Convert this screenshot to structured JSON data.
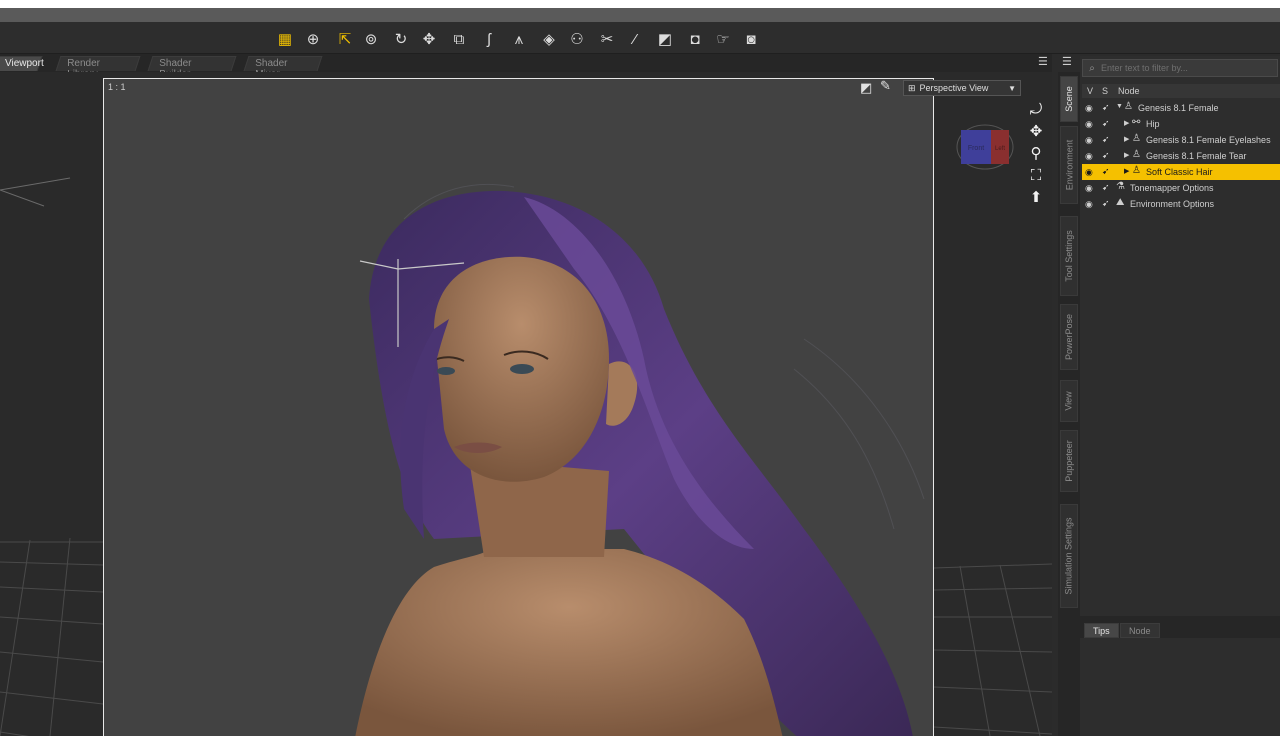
{
  "toolbar": {
    "tools": [
      {
        "name": "pixel-tool-icon",
        "glyph": "▦"
      },
      {
        "name": "universal-tool-icon",
        "glyph": "⊕"
      },
      {
        "name": "node-selection-icon",
        "glyph": "⇱"
      },
      {
        "name": "region-nav-icon",
        "glyph": "⊚"
      },
      {
        "name": "rotate-tool-icon",
        "glyph": "↻"
      },
      {
        "name": "translate-tool-icon",
        "glyph": "✥"
      },
      {
        "name": "scale-tool-icon",
        "glyph": "⧉"
      },
      {
        "name": "joint-editor-icon",
        "glyph": "ʃ"
      },
      {
        "name": "surface-tool-icon",
        "glyph": "⩚"
      },
      {
        "name": "geometry-editor-icon",
        "glyph": "◈"
      },
      {
        "name": "morph-tool-icon",
        "glyph": "⚇"
      },
      {
        "name": "active-pose-icon",
        "glyph": "✂"
      },
      {
        "name": "weight-brush-icon",
        "glyph": "⁄"
      },
      {
        "name": "geometry-sculptor-icon",
        "glyph": "◩"
      },
      {
        "name": "spot-render-icon",
        "glyph": "◘"
      },
      {
        "name": "pointer-icon",
        "glyph": "☞"
      },
      {
        "name": "camera-icon",
        "glyph": "◙"
      }
    ]
  },
  "tabs": [
    {
      "label": "Viewport",
      "active": true
    },
    {
      "label": "Render Library",
      "active": false
    },
    {
      "label": "Shader Builder",
      "active": false
    },
    {
      "label": "Shader Mixer",
      "active": false
    }
  ],
  "viewport": {
    "ratio_label": "1 : 1",
    "camera_label": "Perspective View",
    "navcube_front": "Front",
    "navcube_left": "Left"
  },
  "side_tabs": [
    {
      "label": "Scene",
      "active": true
    },
    {
      "label": "Environment",
      "active": false
    },
    {
      "label": "Tool Settings",
      "active": false
    },
    {
      "label": "PowerPose",
      "active": false
    },
    {
      "label": "View",
      "active": false
    },
    {
      "label": "Puppeteer",
      "active": false
    },
    {
      "label": "Simulation Settings",
      "active": false
    }
  ],
  "scene": {
    "search_placeholder": "Enter text to filter by...",
    "col_v": "V",
    "col_s": "S",
    "col_node": "Node",
    "nodes": [
      {
        "label": "Genesis 8.1 Female",
        "depth": 0,
        "expanded": true,
        "icon": "figure-icon",
        "selected": false
      },
      {
        "label": "Hip",
        "depth": 1,
        "expanded": false,
        "icon": "bone-icon",
        "selected": false
      },
      {
        "label": "Genesis 8.1 Female Eyelashes",
        "depth": 1,
        "expanded": false,
        "icon": "figure-icon",
        "selected": false
      },
      {
        "label": "Genesis 8.1 Female Tear",
        "depth": 1,
        "expanded": false,
        "icon": "figure-icon",
        "selected": false
      },
      {
        "label": "Soft Classic Hair",
        "depth": 1,
        "expanded": false,
        "icon": "figure-icon",
        "selected": true
      },
      {
        "label": "Tonemapper Options",
        "depth": 0,
        "expanded": null,
        "icon": "tonemapper-icon",
        "selected": false
      },
      {
        "label": "Environment Options",
        "depth": 0,
        "expanded": null,
        "icon": "environment-icon",
        "selected": false
      }
    ]
  },
  "bottom_tabs": [
    {
      "label": "Tips",
      "active": true
    },
    {
      "label": "Node",
      "active": false
    }
  ]
}
